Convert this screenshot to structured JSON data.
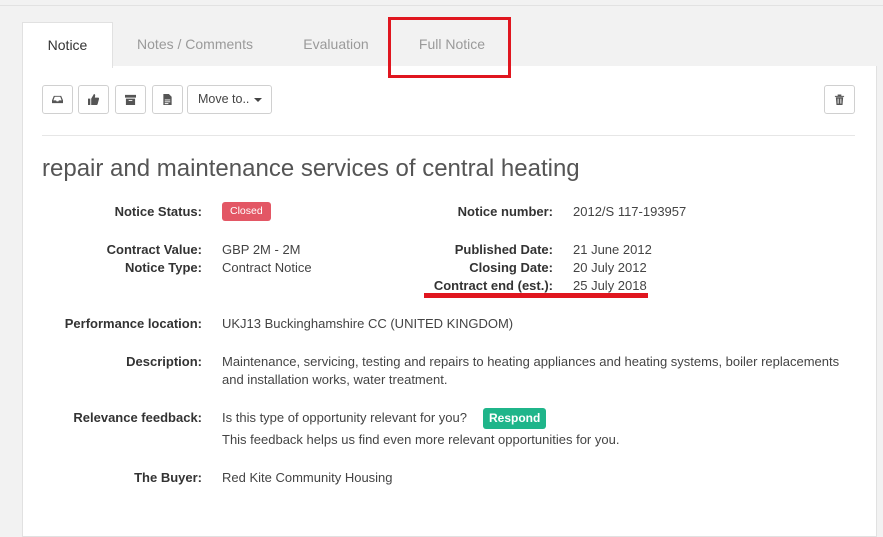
{
  "tabs": [
    {
      "label": "Notice",
      "active": true
    },
    {
      "label": "Notes / Comments",
      "active": false
    },
    {
      "label": "Evaluation",
      "active": false
    },
    {
      "label": "Full Notice",
      "active": false
    }
  ],
  "toolbar": {
    "icons": [
      "inbox-icon",
      "thumbs-up-icon",
      "archive-icon",
      "document-icon",
      "trash-icon"
    ],
    "move_label": "Move to.."
  },
  "notice": {
    "title": "repair and maintenance services of central heating",
    "status_label": "Notice Status:",
    "status_value": "Closed",
    "number_label": "Notice number:",
    "number_value": "2012/S 117-193957",
    "value_label": "Contract Value:",
    "value_value": "GBP 2M - 2M",
    "type_label": "Notice Type:",
    "type_value": "Contract Notice",
    "published_label": "Published Date:",
    "published_value": "21 June 2012",
    "closing_label": "Closing Date:",
    "closing_value": "20 July 2012",
    "end_label": "Contract end (est.):",
    "end_value": "25 July 2018",
    "location_label": "Performance location:",
    "location_value": "UKJ13 Buckinghamshire CC (UNITED KINGDOM)",
    "description_label": "Description:",
    "description_value": "Maintenance, servicing, testing and repairs to heating appliances and heating systems, boiler replacements and installation works, water treatment.",
    "relevance_label": "Relevance feedback:",
    "relevance_question": "Is this type of opportunity relevant for you?",
    "respond_label": "Respond",
    "relevance_note": "This feedback helps us find even more relevant opportunities for you.",
    "buyer_label": "The Buyer:",
    "buyer_value": "Red Kite Community Housing"
  },
  "colors": {
    "closed_badge": "#e35765",
    "respond_button": "#1fb58a",
    "annotation_red": "#e0161f"
  }
}
